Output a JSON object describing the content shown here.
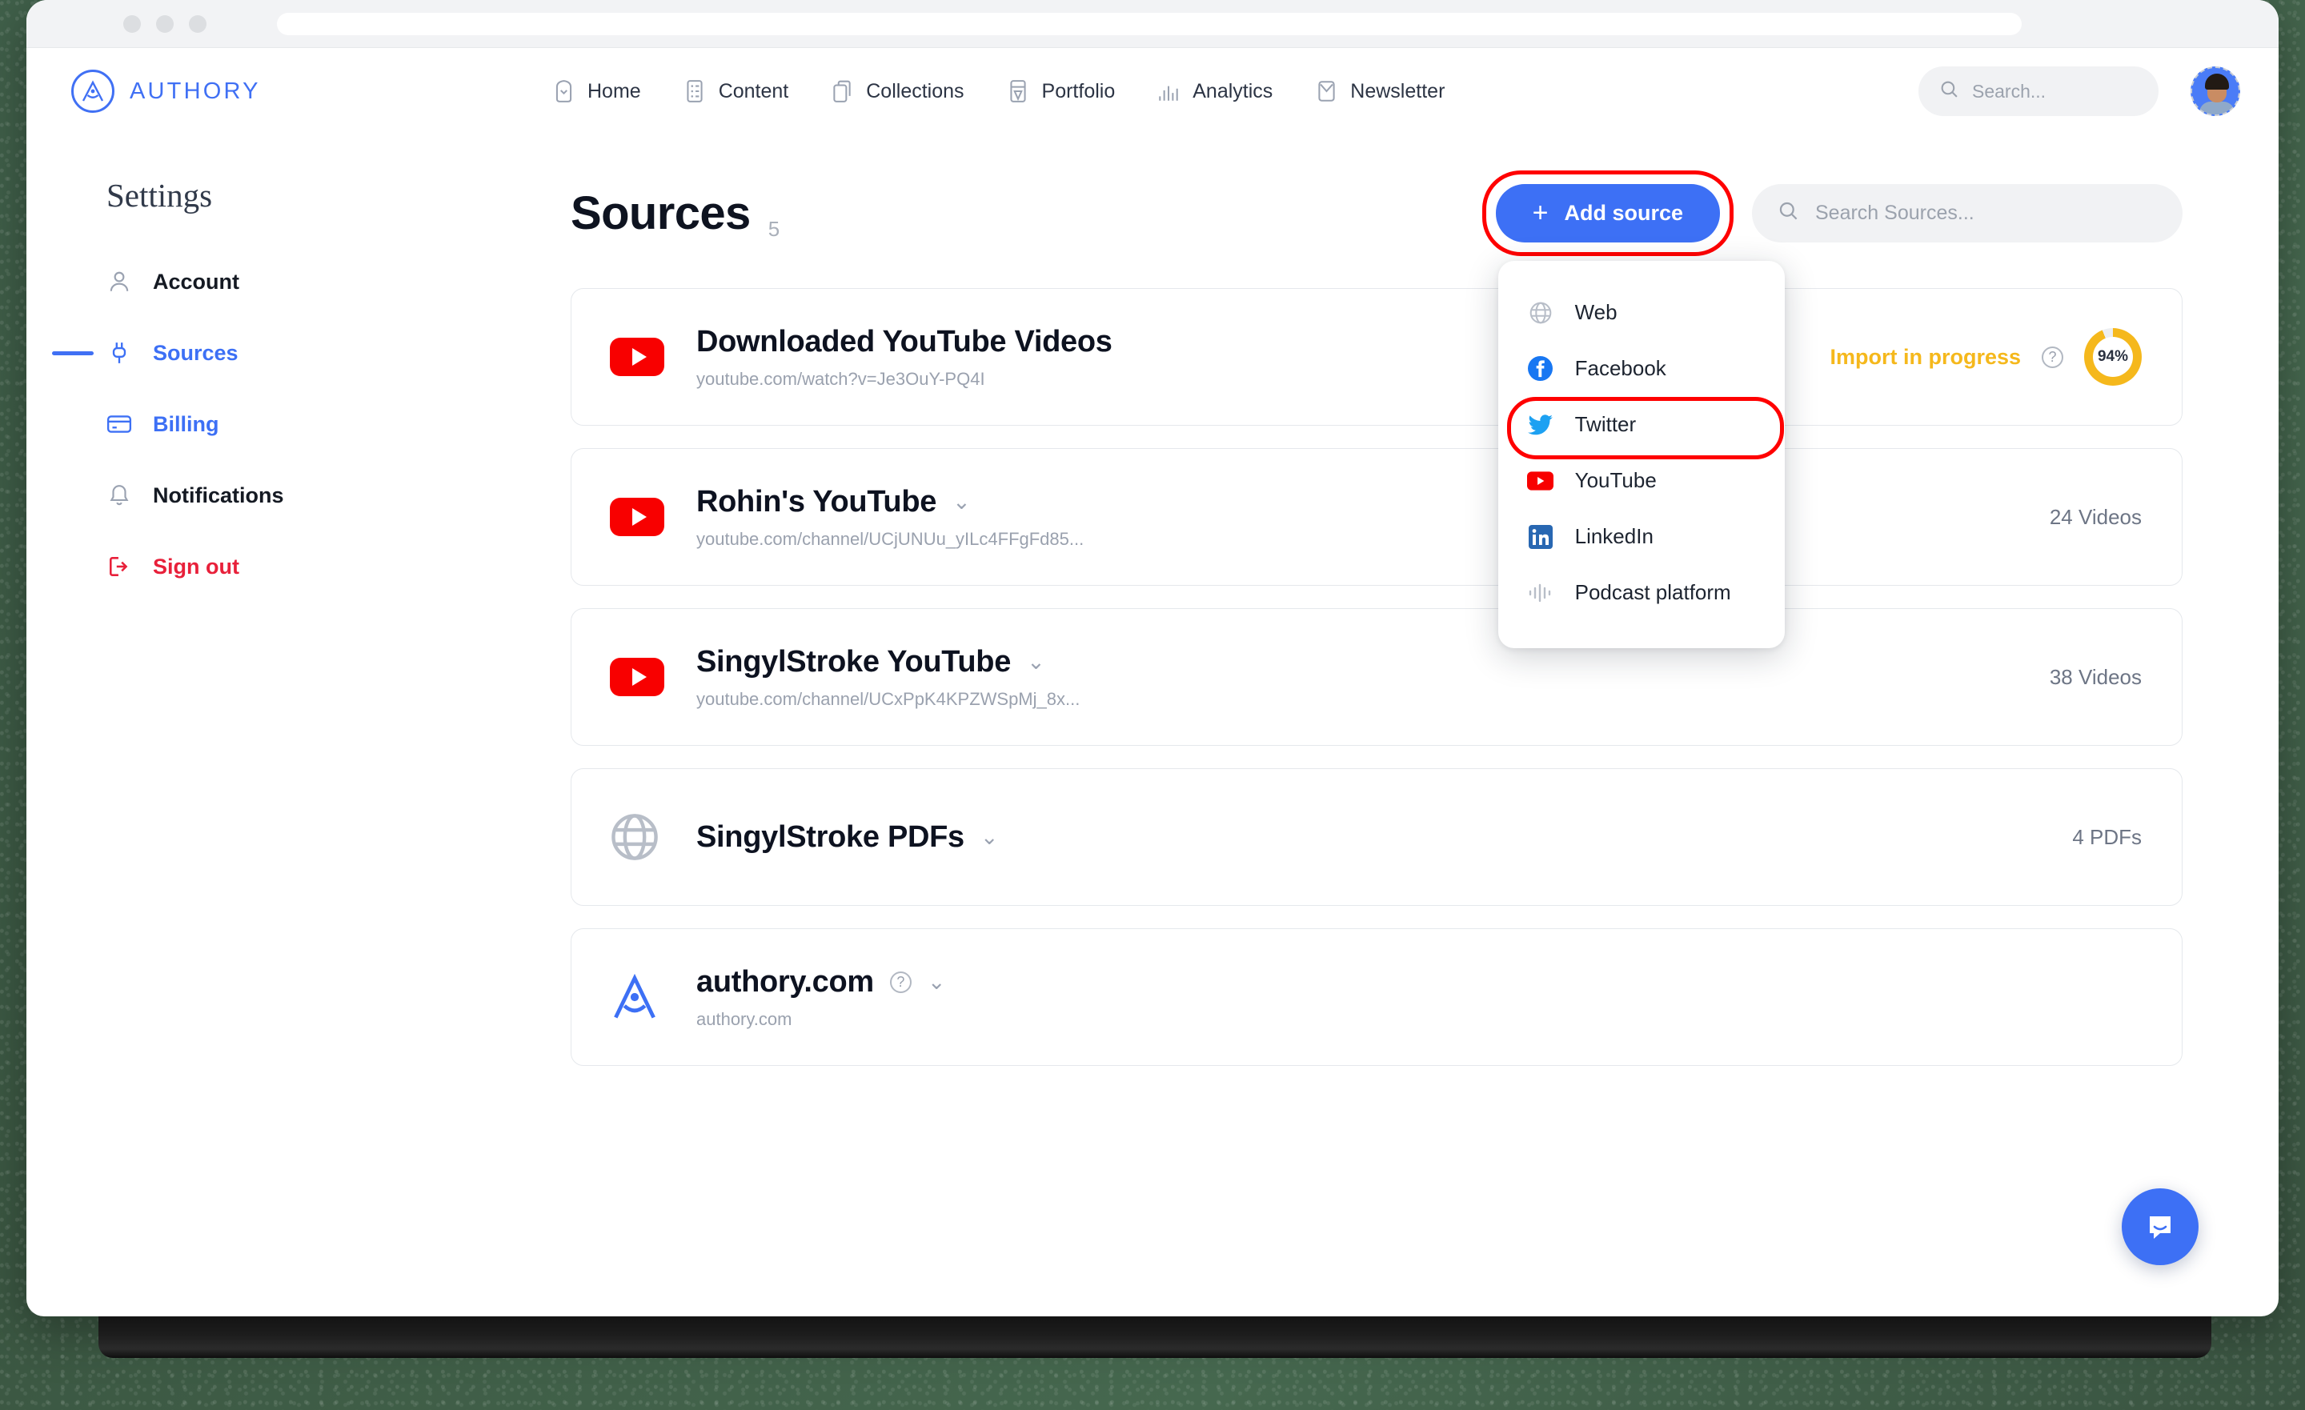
{
  "browser": {
    "dots": [
      "dot-1",
      "dot-2",
      "dot-3"
    ],
    "url_value": ""
  },
  "header": {
    "logo_text": "AUTHORY",
    "nav": [
      {
        "label": "Home",
        "icon": "home-icon"
      },
      {
        "label": "Content",
        "icon": "content-icon"
      },
      {
        "label": "Collections",
        "icon": "collections-icon"
      },
      {
        "label": "Portfolio",
        "icon": "portfolio-icon"
      },
      {
        "label": "Analytics",
        "icon": "analytics-icon"
      },
      {
        "label": "Newsletter",
        "icon": "newsletter-icon"
      }
    ],
    "search_placeholder": "Search...",
    "search_value": "",
    "avatar_name": "user-avatar"
  },
  "sidebar": {
    "title": "Settings",
    "items": [
      {
        "label": "Account",
        "icon": "person-icon",
        "state": "dark",
        "active": false
      },
      {
        "label": "Sources",
        "icon": "plug-icon",
        "state": "blue",
        "active": true
      },
      {
        "label": "Billing",
        "icon": "card-icon",
        "state": "blue",
        "active": false
      },
      {
        "label": "Notifications",
        "icon": "bell-icon",
        "state": "dark",
        "active": false
      },
      {
        "label": "Sign out",
        "icon": "signout-icon",
        "state": "red",
        "active": false
      }
    ]
  },
  "main": {
    "page_title": "Sources",
    "page_count": "5",
    "add_button_label": "Add source",
    "add_button_plus": "+",
    "search_placeholder": "Search Sources...",
    "search_value": "",
    "accent_blue": "#3D70F5",
    "highlight_red": "#FF0000",
    "progress_amber": "#F5B81C"
  },
  "dropdown": {
    "items": [
      {
        "label": "Web",
        "icon": "globe-icon",
        "highlighted": false
      },
      {
        "label": "Facebook",
        "icon": "facebook-icon",
        "highlighted": false
      },
      {
        "label": "Twitter",
        "icon": "twitter-icon",
        "highlighted": true
      },
      {
        "label": "YouTube",
        "icon": "youtube-icon",
        "highlighted": false
      },
      {
        "label": "LinkedIn",
        "icon": "linkedin-icon",
        "highlighted": false
      },
      {
        "label": "Podcast platform",
        "icon": "podcast-icon",
        "highlighted": false
      }
    ]
  },
  "sources": [
    {
      "title": "Downloaded YouTube Videos",
      "url": "youtube.com/watch?v=Je3OuY-PQ4I",
      "icon": "youtube-icon",
      "has_chevron": false,
      "has_help": false,
      "status_label": "Import in progress",
      "progress_percent": "94%",
      "progress_value": 94,
      "count": ""
    },
    {
      "title": "Rohin's YouTube",
      "url": "youtube.com/channel/UCjUNUu_yILc4FFgFd85...",
      "icon": "youtube-icon",
      "has_chevron": true,
      "has_help": false,
      "status_label": "",
      "progress_percent": "",
      "count": "24 Videos"
    },
    {
      "title": "SingylStroke YouTube",
      "url": "youtube.com/channel/UCxPpK4KPZWSpMj_8x...",
      "icon": "youtube-icon",
      "has_chevron": true,
      "has_help": false,
      "status_label": "",
      "progress_percent": "",
      "count": "38 Videos"
    },
    {
      "title": "SingylStroke PDFs",
      "url": "",
      "icon": "globe-icon",
      "has_chevron": true,
      "has_help": false,
      "status_label": "",
      "progress_percent": "",
      "count": "4 PDFs"
    },
    {
      "title": "authory.com",
      "url": "authory.com",
      "icon": "authory-icon",
      "has_chevron": true,
      "has_help": true,
      "status_label": "",
      "progress_percent": "",
      "count": ""
    }
  ],
  "widget": {
    "name": "intercom-chat-button"
  }
}
